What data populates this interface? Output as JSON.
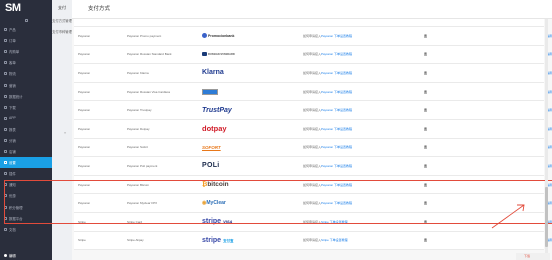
{
  "brand": {
    "logo": "SM"
  },
  "sidebar": {
    "items": [
      {
        "label": "产品",
        "icon": "box-icon"
      },
      {
        "label": "订单",
        "icon": "list-icon"
      },
      {
        "label": "内购单",
        "icon": "cart-icon"
      },
      {
        "label": "客单",
        "icon": "user-icon"
      },
      {
        "label": "物流",
        "icon": "truck-icon"
      },
      {
        "label": "营销",
        "icon": "gift-icon"
      },
      {
        "label": "数据统计",
        "icon": "chart-icon"
      },
      {
        "label": "下载",
        "icon": "download-icon"
      },
      {
        "label": "APP",
        "icon": "app-icon"
      },
      {
        "label": "报表",
        "icon": "report-icon"
      },
      {
        "label": "分销",
        "icon": "share-icon"
      },
      {
        "label": "店铺",
        "icon": "shop-icon"
      },
      {
        "label": "设置",
        "icon": "gear-icon",
        "active": true
      },
      {
        "label": "插件",
        "icon": "plugin-icon"
      },
      {
        "label": "通知",
        "icon": "bell-icon"
      },
      {
        "label": "优惠",
        "icon": "tag-icon"
      },
      {
        "label": "积分管理",
        "icon": "coin-icon"
      },
      {
        "label": "数据平台",
        "icon": "database-icon"
      },
      {
        "label": "文档",
        "icon": "doc-icon"
      }
    ],
    "user": "编辑"
  },
  "sub_nav": {
    "title": "支付",
    "items": [
      "支付方式管理",
      "支付币种管理"
    ],
    "collapse": "«"
  },
  "page": {
    "title": "支付方式"
  },
  "table": {
    "rows": [
      {
        "provider": "Payssion",
        "method": "Payssion Przelewy24 Poland",
        "logo": "Przelewy24",
        "logo_style": "przelewy",
        "desc_prefix": "如何申请接入",
        "desc_link": "Payssion 下单设置教程",
        "status": "否",
        "action": "编辑",
        "first": true
      },
      {
        "provider": "Payssion",
        "method": "Payssion Promo payment",
        "logo": "Promocionbank",
        "logo_style": "promo",
        "desc_prefix": "如何申请接入",
        "desc_link": "Payssion 下单设置教程",
        "status": "否",
        "action": "编辑"
      },
      {
        "provider": "Payssion",
        "method": "Payssion Russian Standard Bank",
        "logo": "RUSSIAN STANDARD",
        "logo_style": "bank",
        "desc_prefix": "如何申请接入",
        "desc_link": "Payssion 下单设置教程",
        "status": "否",
        "action": "编辑"
      },
      {
        "provider": "Payssion",
        "method": "Payssion Klarna",
        "logo": "Klarna",
        "logo_style": "klarna",
        "desc_prefix": "如何申请接入",
        "desc_link": "Payssion 下单设置教程",
        "status": "否",
        "action": "编辑"
      },
      {
        "provider": "Payssion",
        "method": "Payssion Russian Visa Cardless",
        "logo": "",
        "logo_style": "bluebox",
        "desc_prefix": "如何申请接入",
        "desc_link": "Payssion 下单设置教程",
        "status": "否",
        "action": "编辑"
      },
      {
        "provider": "Payssion",
        "method": "Payssion Trustpay",
        "logo": "TrustPay",
        "logo_style": "trustpay",
        "desc_prefix": "如何申请接入",
        "desc_link": "Payssion 下单设置教程",
        "status": "否",
        "action": "编辑"
      },
      {
        "provider": "Payssion",
        "method": "Payssion Dotpay",
        "logo": "dotpay",
        "logo_style": "dotpay",
        "desc_prefix": "如何申请接入",
        "desc_link": "Payssion 下单设置教程",
        "status": "否",
        "action": "编辑"
      },
      {
        "provider": "Payssion",
        "method": "Payssion Sofort",
        "logo": "SOFORT",
        "logo_style": "sofort",
        "desc_prefix": "如何申请接入",
        "desc_link": "Payssion 下单设置教程",
        "status": "否",
        "action": "编辑"
      },
      {
        "provider": "Payssion",
        "method": "Payssion Poli payment",
        "logo": "POLi",
        "logo_style": "poli",
        "desc_prefix": "如何申请接入",
        "desc_link": "Payssion 下单设置教程",
        "status": "否",
        "action": "编辑"
      },
      {
        "provider": "Payssion",
        "method": "Payssion Bitcoin",
        "logo": "bitcoin",
        "logo_style": "bitcoin",
        "desc_prefix": "如何申请接入",
        "desc_link": "Payssion 下单设置教程",
        "status": "否",
        "action": "编辑"
      },
      {
        "provider": "Payssion",
        "method": "Payssion Myclear FPX",
        "logo": "MyClear",
        "logo_style": "myclear",
        "desc_prefix": "如何申请接入",
        "desc_link": "Payssion 下单设置教程",
        "status": "否",
        "action": "编辑"
      },
      {
        "provider": "Stripe",
        "method": "Stripe Card",
        "logo": "stripe",
        "logo_extra": "VISA",
        "logo_style": "stripe-card",
        "desc_prefix": "如何申请接入",
        "desc_link": "Stripe 下单设置教程",
        "status": "否",
        "action": "编辑"
      },
      {
        "provider": "Stripe",
        "method": "Stripe Alipay",
        "logo": "stripe",
        "logo_extra": "支付宝",
        "logo_style": "stripe-alipay",
        "desc_prefix": "如何申请接入",
        "desc_link": "Stripe 下单设置教程",
        "status": "否",
        "action": "编辑"
      }
    ]
  },
  "colors": {
    "sidebar_bg": "#2a2e3c",
    "accent": "#1aa0e6",
    "link": "#1a7ee8",
    "highlight": "#e24b3b"
  },
  "corner_badge": "下载"
}
